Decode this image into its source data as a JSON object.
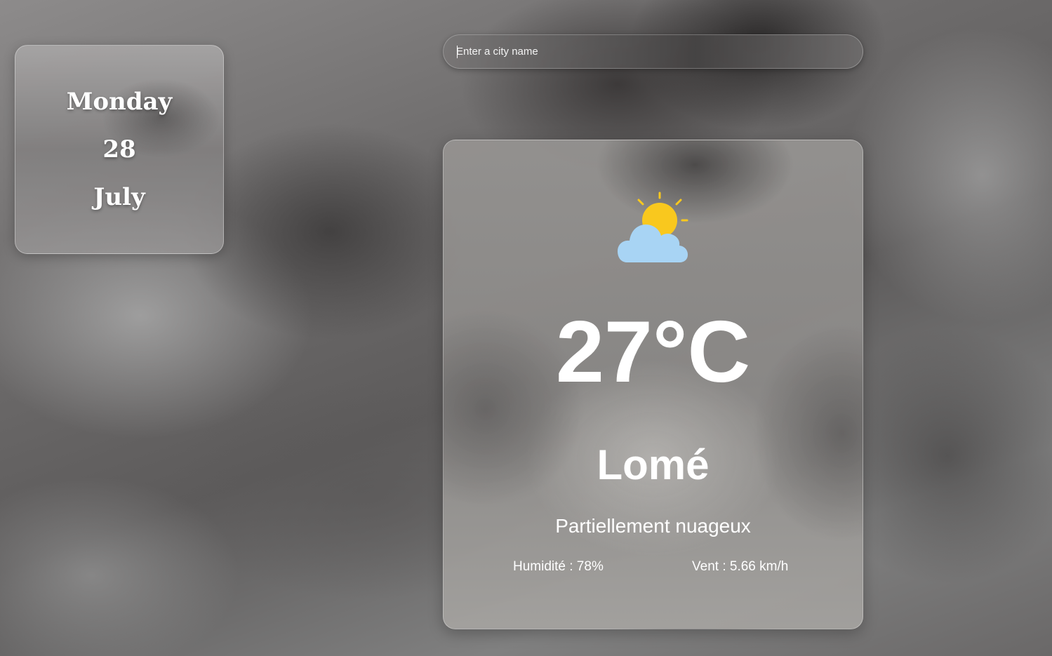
{
  "date": {
    "weekday": "Monday",
    "day": "28",
    "month": "July"
  },
  "search": {
    "placeholder": "Enter a city name",
    "value": ""
  },
  "weather": {
    "icon": "partly-cloudy-icon",
    "temperature": "27°C",
    "city": "Lomé",
    "description": "Partiellement nuageux",
    "humidity": "Humidité : 78%",
    "wind": "Vent : 5.66 km/h"
  },
  "colors": {
    "sun": "#F9C81E",
    "cloud": "#A8D4F4",
    "text": "#FFFFFF"
  }
}
